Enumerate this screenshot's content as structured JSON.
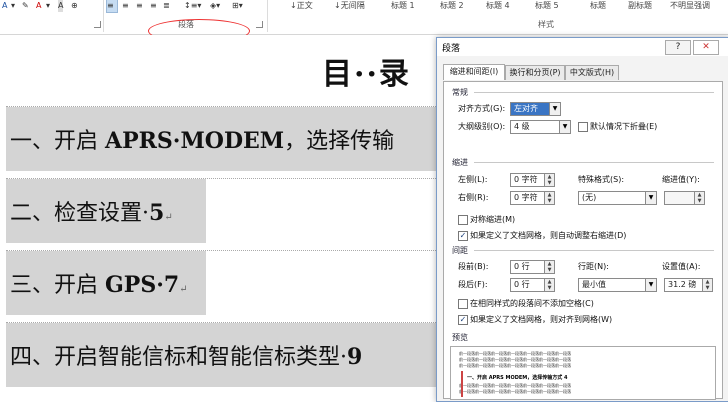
{
  "ribbon": {
    "font_buttons": [
      "A",
      "A",
      "A",
      "⊕"
    ],
    "para_group_label": "段落",
    "style_group_label": "样式",
    "styles": [
      "↓正文",
      "↓无间隔",
      "标题 1",
      "标题 2",
      "标题 4",
      "标题 5",
      "标题",
      "副标题",
      "不明显强调"
    ]
  },
  "document": {
    "title": "目··录",
    "toc": [
      {
        "prefix": "一、开启 ",
        "bold": "APRS·MODEM",
        "suffix": "，选择传输"
      },
      {
        "prefix": "二、检查设置·",
        "bold": "5",
        "suffix": ""
      },
      {
        "prefix": "三、开启 ",
        "bold": "GPS·7",
        "suffix": ""
      },
      {
        "prefix": "四、开启智能信标和智能信标类型·",
        "bold": "9",
        "suffix": ""
      }
    ],
    "return_mark": "↵"
  },
  "dialog": {
    "title": "段落",
    "help_btn": "?",
    "close_btn": "✕",
    "tabs": [
      "缩进和间距(I)",
      "换行和分页(P)",
      "中文版式(H)"
    ],
    "general": {
      "section": "常规",
      "alignment_label": "对齐方式(G):",
      "alignment_value": "左对齐",
      "outline_label": "大纲级别(O):",
      "outline_value": "4 级",
      "collapse_label": "默认情况下折叠(E)"
    },
    "indent": {
      "section": "缩进",
      "left_label": "左侧(L):",
      "left_value": "0 字符",
      "right_label": "右侧(R):",
      "right_value": "0 字符",
      "special_label": "特殊格式(S):",
      "special_value": "(无)",
      "by_label": "缩进值(Y):",
      "by_value": "",
      "mirror_label": "对称缩进(M)",
      "auto_adjust_label": "如果定义了文档网格，则自动调整右缩进(D)"
    },
    "spacing": {
      "section": "间距",
      "before_label": "段前(B):",
      "before_value": "0 行",
      "after_label": "段后(F):",
      "after_value": "0 行",
      "line_label": "行距(N):",
      "line_value": "最小值",
      "at_label": "设置值(A):",
      "at_value": "31.2 磅",
      "no_space_label": "在相同样式的段落间不添加空格(C)",
      "snap_grid_label": "如果定义了文档网格，则对齐到网格(W)"
    },
    "preview": {
      "section": "预览",
      "sample_line": "一、开启 APRS MODEM，选择传输方式 4",
      "filler_text": "前一段落前一段落前一段落前一段落前一段落前一段落前一段落"
    }
  },
  "colors": {
    "accent": "#3a75c4",
    "annotation": "#e33333",
    "toc_bg": "#d4d4d4"
  }
}
